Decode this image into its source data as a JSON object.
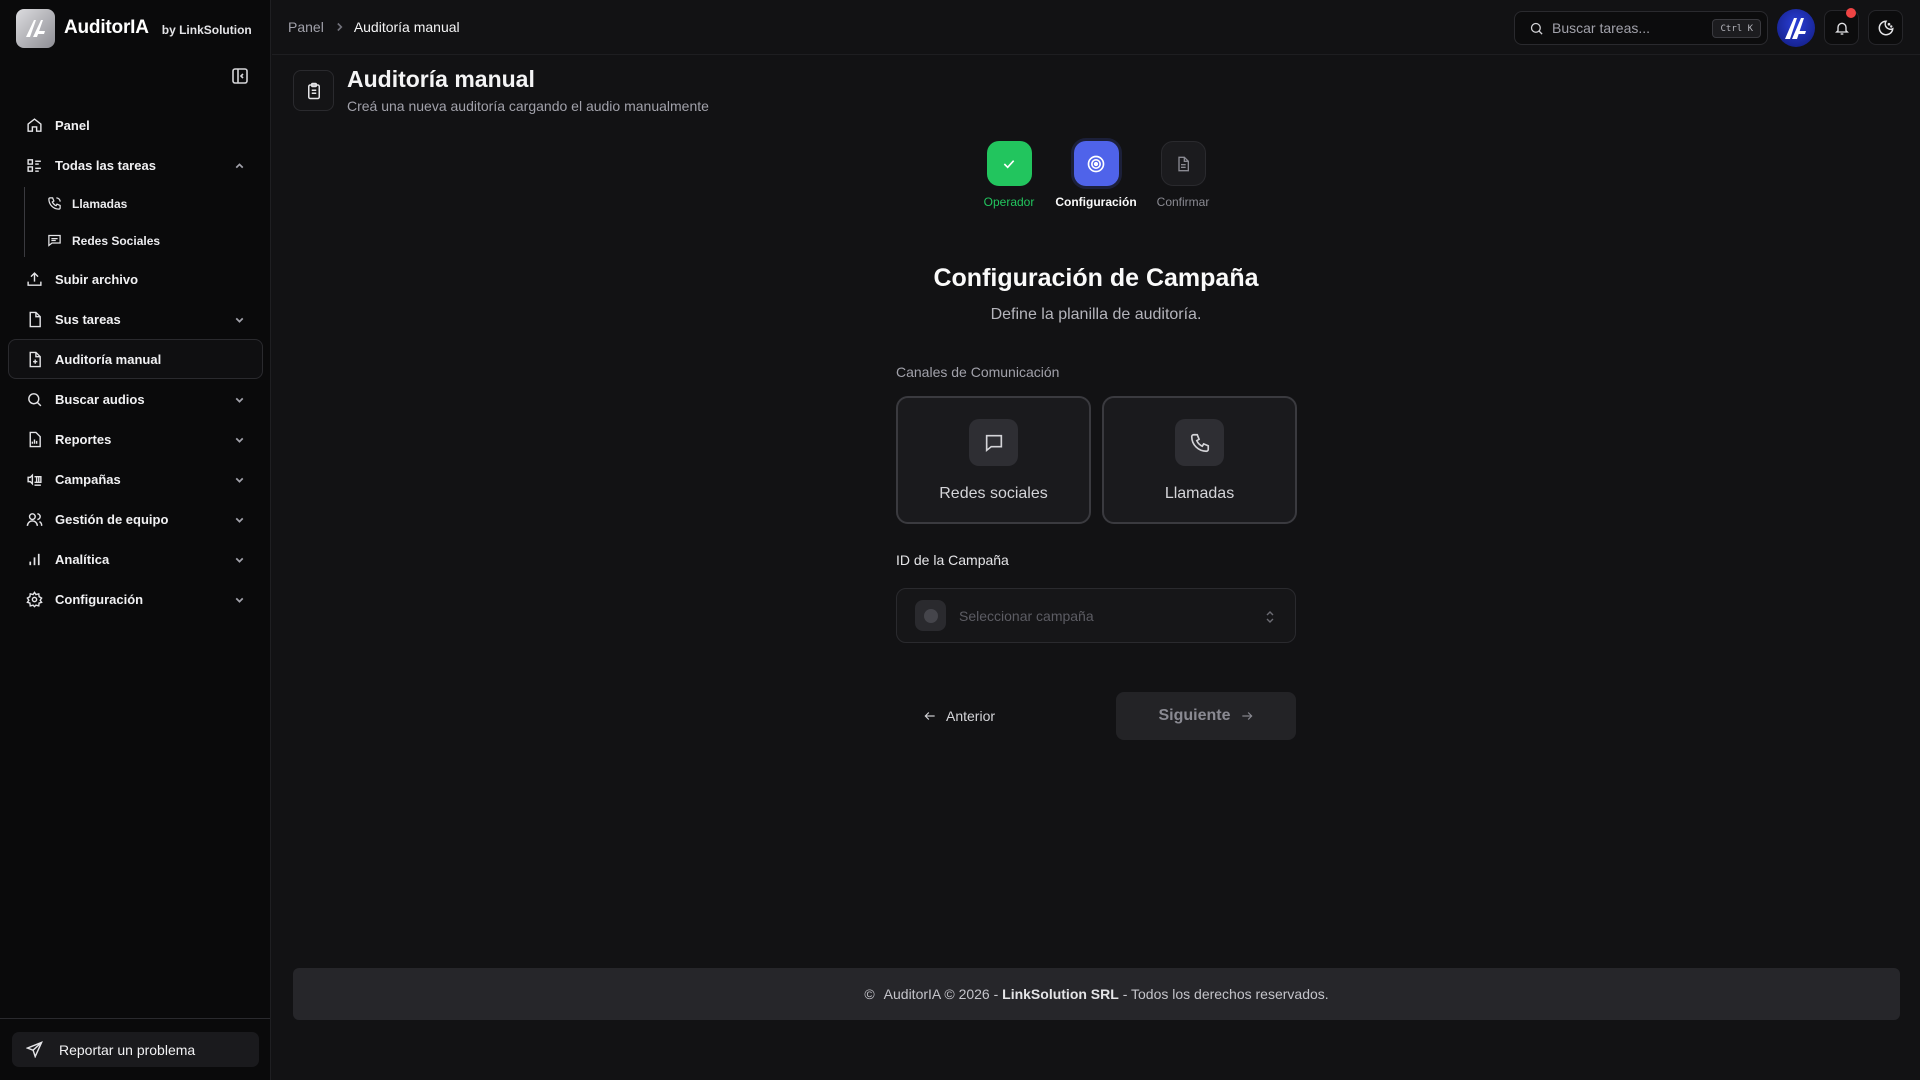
{
  "brand": {
    "name": "AuditorIA",
    "by": "by LinkSolution"
  },
  "sidebar": {
    "items": [
      {
        "label": "Panel",
        "icon": "home-icon"
      },
      {
        "label": "Todas las tareas",
        "icon": "list-icon",
        "expanded": true,
        "children": [
          {
            "label": "Llamadas",
            "icon": "phone-icon"
          },
          {
            "label": "Redes Sociales",
            "icon": "message-icon"
          }
        ]
      },
      {
        "label": "Subir archivo",
        "icon": "upload-icon"
      },
      {
        "label": "Sus tareas",
        "icon": "file-icon"
      },
      {
        "label": "Auditoría manual",
        "icon": "file-plus-icon",
        "active": true
      },
      {
        "label": "Buscar audios",
        "icon": "search-icon"
      },
      {
        "label": "Reportes",
        "icon": "report-icon"
      },
      {
        "label": "Campañas",
        "icon": "campaign-icon"
      },
      {
        "label": "Gestión de equipo",
        "icon": "users-icon"
      },
      {
        "label": "Analítica",
        "icon": "chart-icon"
      },
      {
        "label": "Configuración",
        "icon": "gear-icon"
      }
    ],
    "report_button": "Reportar un problema"
  },
  "header": {
    "breadcrumb": {
      "home": "Panel",
      "current": "Auditoría manual"
    },
    "search": {
      "placeholder": "Buscar tareas...",
      "shortcut": "Ctrl K"
    }
  },
  "page": {
    "title": "Auditoría manual",
    "subtitle": "Creá una nueva auditoría cargando el audio manualmente"
  },
  "steps": [
    {
      "label": "Operador",
      "state": "done"
    },
    {
      "label": "Configuración",
      "state": "active"
    },
    {
      "label": "Confirmar",
      "state": "pending"
    }
  ],
  "form": {
    "title": "Configuración de Campaña",
    "subtitle": "Define la planilla de auditoría.",
    "channels_label": "Canales de Comunicación",
    "channels": [
      {
        "label": "Redes sociales",
        "icon": "chat-icon"
      },
      {
        "label": "Llamadas",
        "icon": "phone-icon"
      }
    ],
    "campaign_label": "ID de la Campaña",
    "campaign_placeholder": "Seleccionar campaña",
    "prev_label": "Anterior",
    "next_label": "Siguiente"
  },
  "footer": {
    "prefix": "AuditorIA © 2026 -",
    "company": "LinkSolution SRL",
    "suffix": "- Todos los derechos reservados."
  },
  "colors": {
    "background": "#121214",
    "sidebar": "#0a0a0b",
    "step_done": "#22c55e",
    "step_active": "#4f63ea",
    "notification": "#ef4444"
  }
}
